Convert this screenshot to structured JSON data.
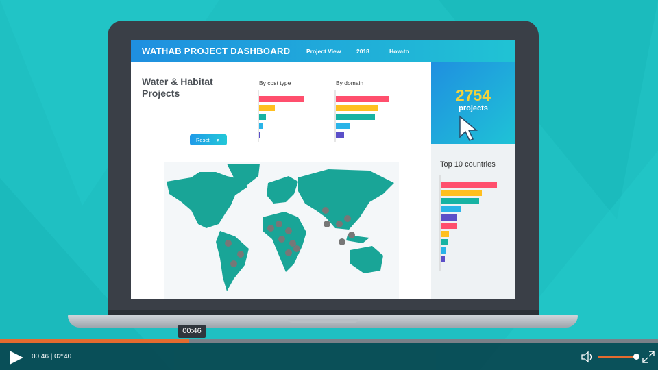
{
  "dashboard": {
    "title": "WATHAB PROJECT DASHBOARD",
    "nav": [
      "Project View",
      "2018",
      "How-to"
    ],
    "panel_title": "Water & Habitat Projects",
    "cost_label": "By cost type",
    "domain_label": "By domain",
    "reset_label": "Reset",
    "project_count": "2754",
    "project_count_label": "projects",
    "top10_title": "Top 10 countries"
  },
  "bar_colors": [
    "#ff4f6d",
    "#ffbf1f",
    "#17b3a3",
    "#2ab4e8",
    "#5b4fc8"
  ],
  "player": {
    "tooltip_time": "00:46",
    "time_display": "00:46 | 02:40",
    "progress_fraction": 0.2875,
    "volume_level": 0.9
  },
  "colors": {
    "background": "#1fc0c2",
    "progress": "#e46b2f",
    "accent_yellow": "#f5d33a"
  },
  "icons": [
    "play-icon",
    "volume-icon",
    "fullscreen-icon",
    "cursor-arrow-icon",
    "map-pin-icon",
    "dropdown-caret-icon"
  ]
}
